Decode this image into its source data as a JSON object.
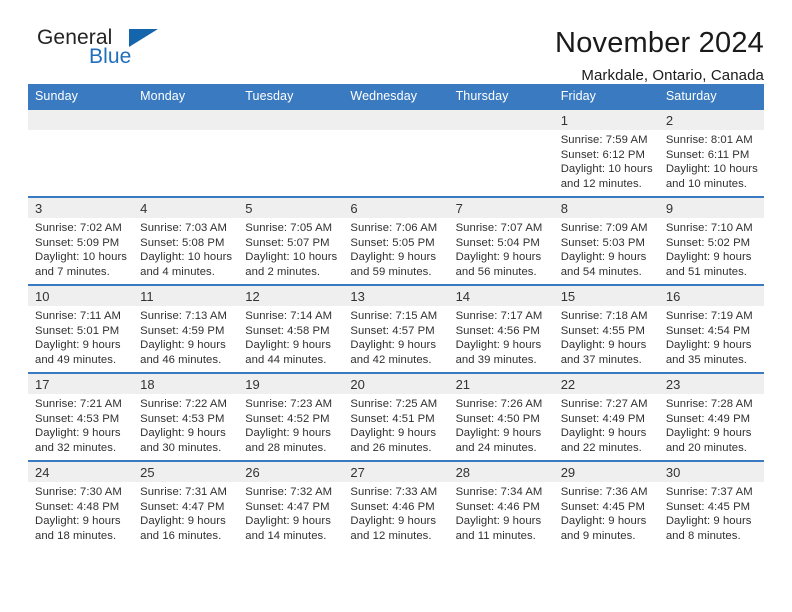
{
  "brand": {
    "name_part1": "General",
    "name_part2": "Blue",
    "accent_color": "#1565ad"
  },
  "header": {
    "month_title": "November 2024",
    "location": "Markdale, Ontario, Canada"
  },
  "theme": {
    "header_blue": "#3a7ac0",
    "daynum_gray": "#efefef",
    "text_color": "#303030"
  },
  "weekdays": [
    "Sunday",
    "Monday",
    "Tuesday",
    "Wednesday",
    "Thursday",
    "Friday",
    "Saturday"
  ],
  "weeks": [
    [
      {
        "day": "",
        "lines": []
      },
      {
        "day": "",
        "lines": []
      },
      {
        "day": "",
        "lines": []
      },
      {
        "day": "",
        "lines": []
      },
      {
        "day": "",
        "lines": []
      },
      {
        "day": "1",
        "lines": [
          "Sunrise: 7:59 AM",
          "Sunset: 6:12 PM",
          "Daylight: 10 hours",
          "and 12 minutes."
        ]
      },
      {
        "day": "2",
        "lines": [
          "Sunrise: 8:01 AM",
          "Sunset: 6:11 PM",
          "Daylight: 10 hours",
          "and 10 minutes."
        ]
      }
    ],
    [
      {
        "day": "3",
        "lines": [
          "Sunrise: 7:02 AM",
          "Sunset: 5:09 PM",
          "Daylight: 10 hours",
          "and 7 minutes."
        ]
      },
      {
        "day": "4",
        "lines": [
          "Sunrise: 7:03 AM",
          "Sunset: 5:08 PM",
          "Daylight: 10 hours",
          "and 4 minutes."
        ]
      },
      {
        "day": "5",
        "lines": [
          "Sunrise: 7:05 AM",
          "Sunset: 5:07 PM",
          "Daylight: 10 hours",
          "and 2 minutes."
        ]
      },
      {
        "day": "6",
        "lines": [
          "Sunrise: 7:06 AM",
          "Sunset: 5:05 PM",
          "Daylight: 9 hours",
          "and 59 minutes."
        ]
      },
      {
        "day": "7",
        "lines": [
          "Sunrise: 7:07 AM",
          "Sunset: 5:04 PM",
          "Daylight: 9 hours",
          "and 56 minutes."
        ]
      },
      {
        "day": "8",
        "lines": [
          "Sunrise: 7:09 AM",
          "Sunset: 5:03 PM",
          "Daylight: 9 hours",
          "and 54 minutes."
        ]
      },
      {
        "day": "9",
        "lines": [
          "Sunrise: 7:10 AM",
          "Sunset: 5:02 PM",
          "Daylight: 9 hours",
          "and 51 minutes."
        ]
      }
    ],
    [
      {
        "day": "10",
        "lines": [
          "Sunrise: 7:11 AM",
          "Sunset: 5:01 PM",
          "Daylight: 9 hours",
          "and 49 minutes."
        ]
      },
      {
        "day": "11",
        "lines": [
          "Sunrise: 7:13 AM",
          "Sunset: 4:59 PM",
          "Daylight: 9 hours",
          "and 46 minutes."
        ]
      },
      {
        "day": "12",
        "lines": [
          "Sunrise: 7:14 AM",
          "Sunset: 4:58 PM",
          "Daylight: 9 hours",
          "and 44 minutes."
        ]
      },
      {
        "day": "13",
        "lines": [
          "Sunrise: 7:15 AM",
          "Sunset: 4:57 PM",
          "Daylight: 9 hours",
          "and 42 minutes."
        ]
      },
      {
        "day": "14",
        "lines": [
          "Sunrise: 7:17 AM",
          "Sunset: 4:56 PM",
          "Daylight: 9 hours",
          "and 39 minutes."
        ]
      },
      {
        "day": "15",
        "lines": [
          "Sunrise: 7:18 AM",
          "Sunset: 4:55 PM",
          "Daylight: 9 hours",
          "and 37 minutes."
        ]
      },
      {
        "day": "16",
        "lines": [
          "Sunrise: 7:19 AM",
          "Sunset: 4:54 PM",
          "Daylight: 9 hours",
          "and 35 minutes."
        ]
      }
    ],
    [
      {
        "day": "17",
        "lines": [
          "Sunrise: 7:21 AM",
          "Sunset: 4:53 PM",
          "Daylight: 9 hours",
          "and 32 minutes."
        ]
      },
      {
        "day": "18",
        "lines": [
          "Sunrise: 7:22 AM",
          "Sunset: 4:53 PM",
          "Daylight: 9 hours",
          "and 30 minutes."
        ]
      },
      {
        "day": "19",
        "lines": [
          "Sunrise: 7:23 AM",
          "Sunset: 4:52 PM",
          "Daylight: 9 hours",
          "and 28 minutes."
        ]
      },
      {
        "day": "20",
        "lines": [
          "Sunrise: 7:25 AM",
          "Sunset: 4:51 PM",
          "Daylight: 9 hours",
          "and 26 minutes."
        ]
      },
      {
        "day": "21",
        "lines": [
          "Sunrise: 7:26 AM",
          "Sunset: 4:50 PM",
          "Daylight: 9 hours",
          "and 24 minutes."
        ]
      },
      {
        "day": "22",
        "lines": [
          "Sunrise: 7:27 AM",
          "Sunset: 4:49 PM",
          "Daylight: 9 hours",
          "and 22 minutes."
        ]
      },
      {
        "day": "23",
        "lines": [
          "Sunrise: 7:28 AM",
          "Sunset: 4:49 PM",
          "Daylight: 9 hours",
          "and 20 minutes."
        ]
      }
    ],
    [
      {
        "day": "24",
        "lines": [
          "Sunrise: 7:30 AM",
          "Sunset: 4:48 PM",
          "Daylight: 9 hours",
          "and 18 minutes."
        ]
      },
      {
        "day": "25",
        "lines": [
          "Sunrise: 7:31 AM",
          "Sunset: 4:47 PM",
          "Daylight: 9 hours",
          "and 16 minutes."
        ]
      },
      {
        "day": "26",
        "lines": [
          "Sunrise: 7:32 AM",
          "Sunset: 4:47 PM",
          "Daylight: 9 hours",
          "and 14 minutes."
        ]
      },
      {
        "day": "27",
        "lines": [
          "Sunrise: 7:33 AM",
          "Sunset: 4:46 PM",
          "Daylight: 9 hours",
          "and 12 minutes."
        ]
      },
      {
        "day": "28",
        "lines": [
          "Sunrise: 7:34 AM",
          "Sunset: 4:46 PM",
          "Daylight: 9 hours",
          "and 11 minutes."
        ]
      },
      {
        "day": "29",
        "lines": [
          "Sunrise: 7:36 AM",
          "Sunset: 4:45 PM",
          "Daylight: 9 hours",
          "and 9 minutes."
        ]
      },
      {
        "day": "30",
        "lines": [
          "Sunrise: 7:37 AM",
          "Sunset: 4:45 PM",
          "Daylight: 9 hours",
          "and 8 minutes."
        ]
      }
    ]
  ]
}
